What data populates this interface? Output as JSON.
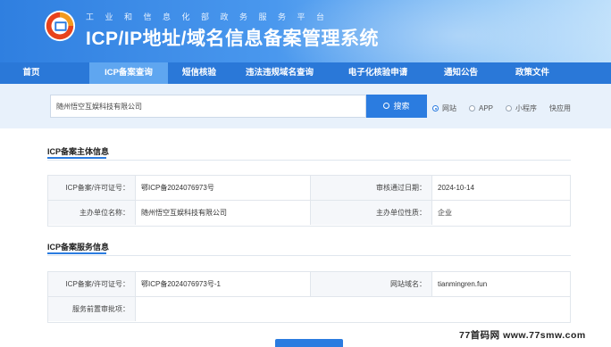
{
  "header": {
    "subtitle": "工业和信息化部政务服务平台",
    "title": "ICP/IP地址/域名信息备案管理系统"
  },
  "nav": {
    "items": [
      {
        "label": "首页",
        "active": false
      },
      {
        "label": "ICP备案查询",
        "active": true
      },
      {
        "label": "短信核验",
        "active": false
      },
      {
        "label": "违法违规域名查询",
        "active": false
      },
      {
        "label": "电子化核验申请",
        "active": false
      },
      {
        "label": "通知公告",
        "active": false
      },
      {
        "label": "政策文件",
        "active": false
      }
    ]
  },
  "search": {
    "value": "随州悟空互娱科技有限公司",
    "button_label": "搜索",
    "options": [
      {
        "label": "网站",
        "checked": true
      },
      {
        "label": "APP",
        "checked": false
      },
      {
        "label": "小程序",
        "checked": false
      },
      {
        "label": "快应用",
        "checked": false
      }
    ]
  },
  "subject_section": {
    "title": "ICP备案主体信息",
    "rows": [
      {
        "label1": "ICP备案/许可证号：",
        "value1": "鄂ICP备2024076973号",
        "label2": "审核通过日期：",
        "value2": "2024-10-14"
      },
      {
        "label1": "主办单位名称：",
        "value1": "随州悟空互娱科技有限公司",
        "label2": "主办单位性质：",
        "value2": "企业"
      }
    ]
  },
  "service_section": {
    "title": "ICP备案服务信息",
    "rows": [
      {
        "label1": "ICP备案/许可证号：",
        "value1": "鄂ICP备2024076973号-1",
        "label2": "网站域名：",
        "value2": "tianmingren.fun"
      },
      {
        "label1": "服务前置审批项：",
        "value1": ""
      }
    ]
  },
  "watermark": "77首码网 www.77smw.com",
  "colors": {
    "primary": "#2b7ce0",
    "nav_bg": "#2a78d8",
    "nav_active": "#5fa6f0",
    "search_band": "#e8f1fb"
  }
}
